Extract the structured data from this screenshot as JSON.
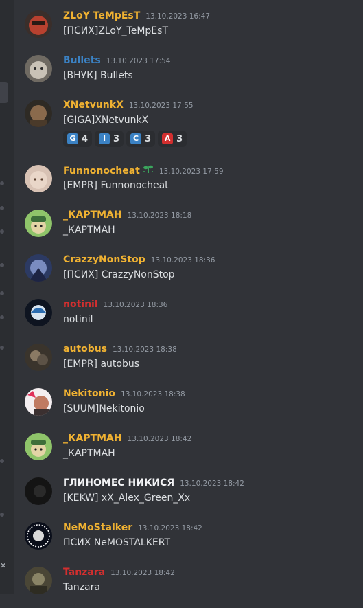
{
  "colors": {
    "yellow": "#f0b232",
    "blue": "#3b82c4",
    "red": "#d32f2f",
    "white": "#f2f3f5",
    "sprout": "#3ba55d"
  },
  "messages": [
    {
      "username": "ZLoY TeMpEsT",
      "timestamp": "13.10.2023 16:47",
      "content": "[ПСИХ]ZLoY_TeMpEsT",
      "name_color": "#f0b232"
    },
    {
      "username": "Bullets",
      "timestamp": "13.10.2023 17:54",
      "content": "[ВНУК] Bullets",
      "name_color": "#3b82c4"
    },
    {
      "username": "XNetvunkX",
      "timestamp": "13.10.2023 17:55",
      "content": "[GIGA]XNetvunkX",
      "name_color": "#f0b232"
    },
    {
      "username": "Funnonocheat",
      "timestamp": "13.10.2023 17:59",
      "content": "[EMPR] Funnonocheat",
      "name_color": "#f0b232"
    },
    {
      "username": "_КАРТМАН",
      "timestamp": "13.10.2023 18:18",
      "content": "_КАРТМАН",
      "name_color": "#f0b232"
    },
    {
      "username": "CrazzyNonStop",
      "timestamp": "13.10.2023 18:36",
      "content": "[ПСИХ] CrazzyNonStop",
      "name_color": "#f0b232"
    },
    {
      "username": "notinil",
      "timestamp": "13.10.2023 18:36",
      "content": "notinil",
      "name_color": "#d32f2f"
    },
    {
      "username": "autobus",
      "timestamp": "13.10.2023 18:38",
      "content": "[EMPR] autobus",
      "name_color": "#f0b232"
    },
    {
      "username": "Nekitonio",
      "timestamp": "13.10.2023 18:38",
      "content": "[SUUM]Nekitonio",
      "name_color": "#f0b232"
    },
    {
      "username": "_КАРТМАН",
      "timestamp": "13.10.2023 18:42",
      "content": "_КАРТМАН",
      "name_color": "#f0b232"
    },
    {
      "username": "ГЛИНОМЕС НИКИСЯ",
      "timestamp": "13.10.2023 18:42",
      "content": "[KEKW] xX_Alex_Green_Xx",
      "name_color": "#f2f3f5"
    },
    {
      "username": "NeMoStalker",
      "timestamp": "13.10.2023 18:42",
      "content": "ПСИХ NeMOSTALKERT",
      "name_color": "#f0b232"
    },
    {
      "username": "Tanzara",
      "timestamp": "13.10.2023 18:42",
      "content": "Tanzara",
      "name_color": "#d32f2f"
    }
  ],
  "reactions": [
    {
      "emoji": "G",
      "count": "4",
      "color": "#3b82c4"
    },
    {
      "emoji": "I",
      "count": "3",
      "color": "#3b82c4"
    },
    {
      "emoji": "C",
      "count": "3",
      "color": "#3b82c4"
    },
    {
      "emoji": "A",
      "count": "3",
      "color": "#d32f2f"
    }
  ],
  "badge_icon": "sprout-icon",
  "rail_icon": "close-icon",
  "rail_glyph": "✕"
}
